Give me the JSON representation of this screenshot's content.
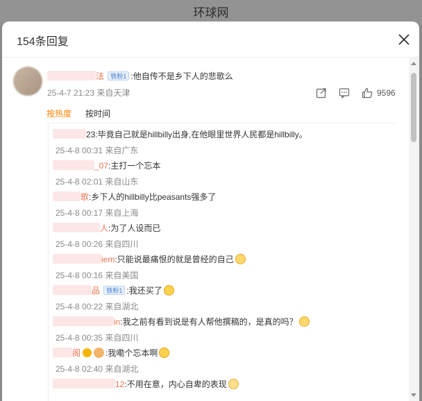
{
  "backdrop": {
    "site_title": "环球网"
  },
  "modal": {
    "title": "154条回复"
  },
  "main_comment": {
    "name_suffix": "法",
    "badge": "铁粉1",
    "text": ":他自传不是乡下人的悲歌么",
    "meta": "25-4-7 21:23 来自天津",
    "like_count": "9596"
  },
  "sort": {
    "hot": "按热度",
    "time": "按时间"
  },
  "replies": [
    {
      "name_suffix": "23",
      "text": ":毕竟自己就是hillbilly出身,在他眼里世界人民都是hillbilly。",
      "meta": "25-4-8 00:31 来自广东"
    },
    {
      "name_suffix": "_07",
      "text": ":主打一个忘本",
      "meta": "25-4-8 02:01 来自山东"
    },
    {
      "name_suffix": "歌",
      "text": ":乡下人的hillbilly比peasants强多了",
      "meta": "25-4-8 00:17 来自上海"
    },
    {
      "name_suffix": "人",
      "text": ":为了人设而已",
      "meta": "25-4-8 00:26 来自四川"
    },
    {
      "name_suffix": "iem",
      "text": ":只能说最痛恨的就是曾经的自己",
      "meta": "25-4-8 00:16 来自美国"
    },
    {
      "name_suffix": "品",
      "badge": "铁粉1",
      "text": ":我还买了",
      "meta": "25-4-8 00:22 来自湖北"
    },
    {
      "name_suffix": "in",
      "text": ":我之前有看到说是有人帮他撰稿的，是真的吗？",
      "meta": "25-4-8 00:35 来自四川"
    },
    {
      "name_suffix": "阁",
      "text": ":我嘞个忘本啊",
      "meta": "25-4-8 02:40 来自湖北"
    },
    {
      "name_suffix": "12",
      "text": ":不用在意，内心自卑的表现",
      "meta": ""
    }
  ],
  "colors": {
    "accent": "#ff8200",
    "nickname": "#eb7350"
  }
}
